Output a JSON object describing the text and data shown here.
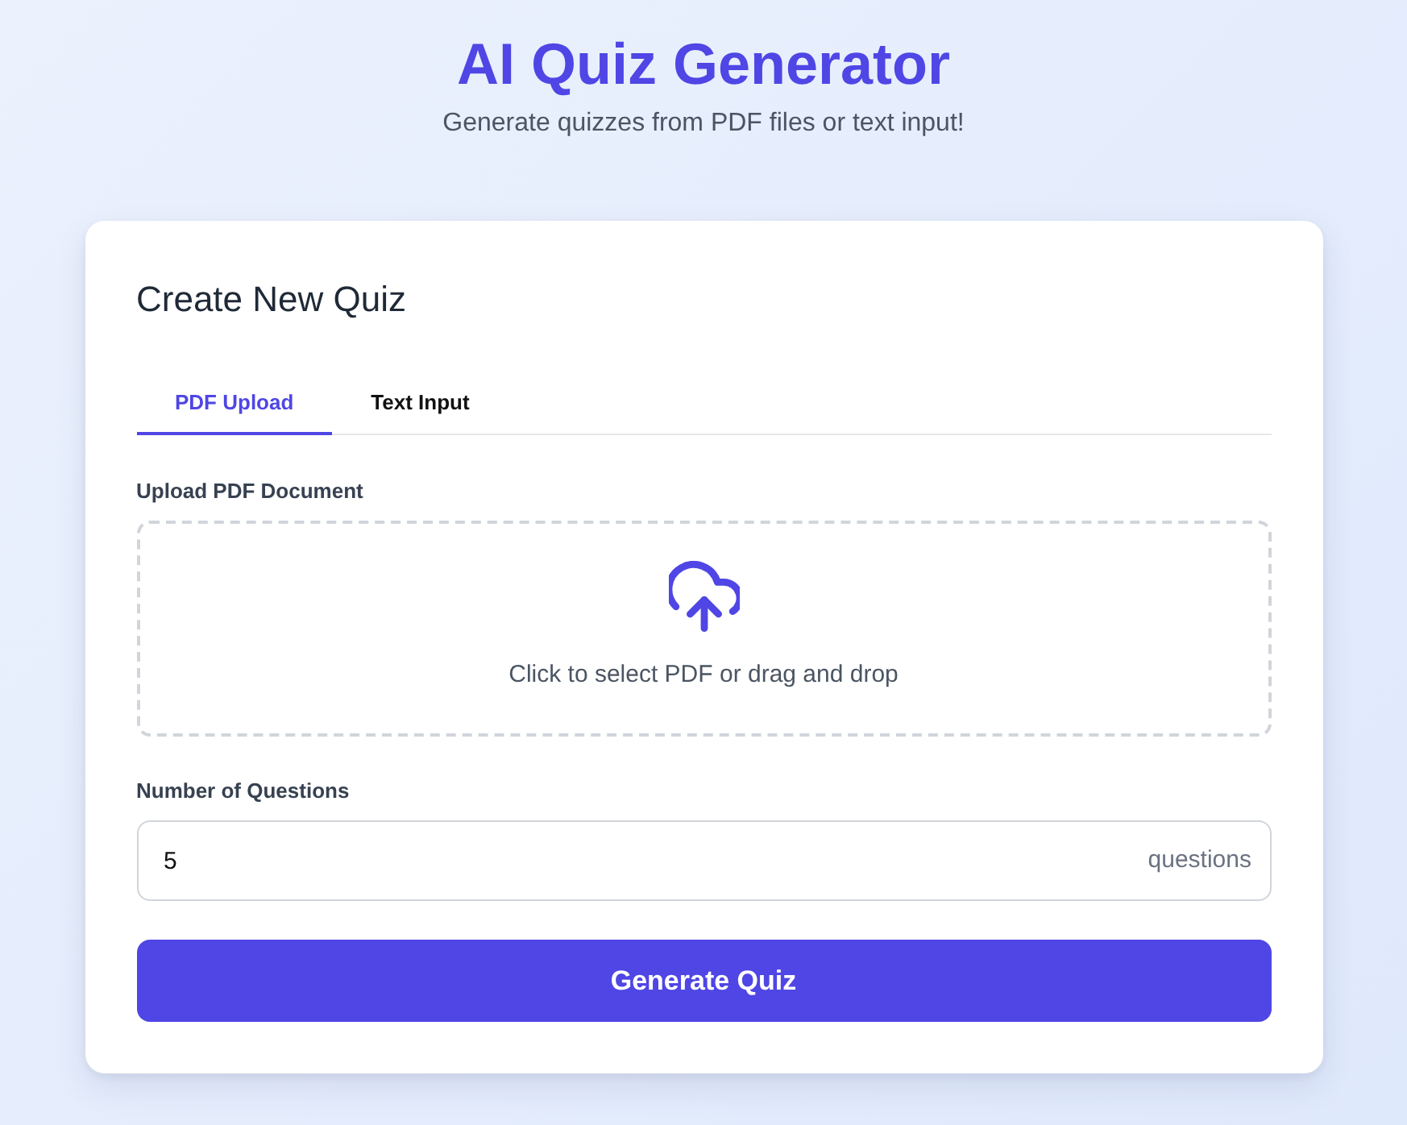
{
  "header": {
    "title": "AI Quiz Generator",
    "subtitle": "Generate quizzes from PDF files or text input!"
  },
  "card": {
    "title": "Create New Quiz",
    "tabs": [
      {
        "label": "PDF Upload",
        "selected": true
      },
      {
        "label": "Text Input",
        "selected": false
      }
    ],
    "upload": {
      "label": "Upload PDF Document",
      "prompt": "Click to select PDF or drag and drop"
    },
    "questions": {
      "label": "Number of Questions",
      "value": "5",
      "suffix": "questions"
    },
    "button": "Generate Quiz"
  }
}
